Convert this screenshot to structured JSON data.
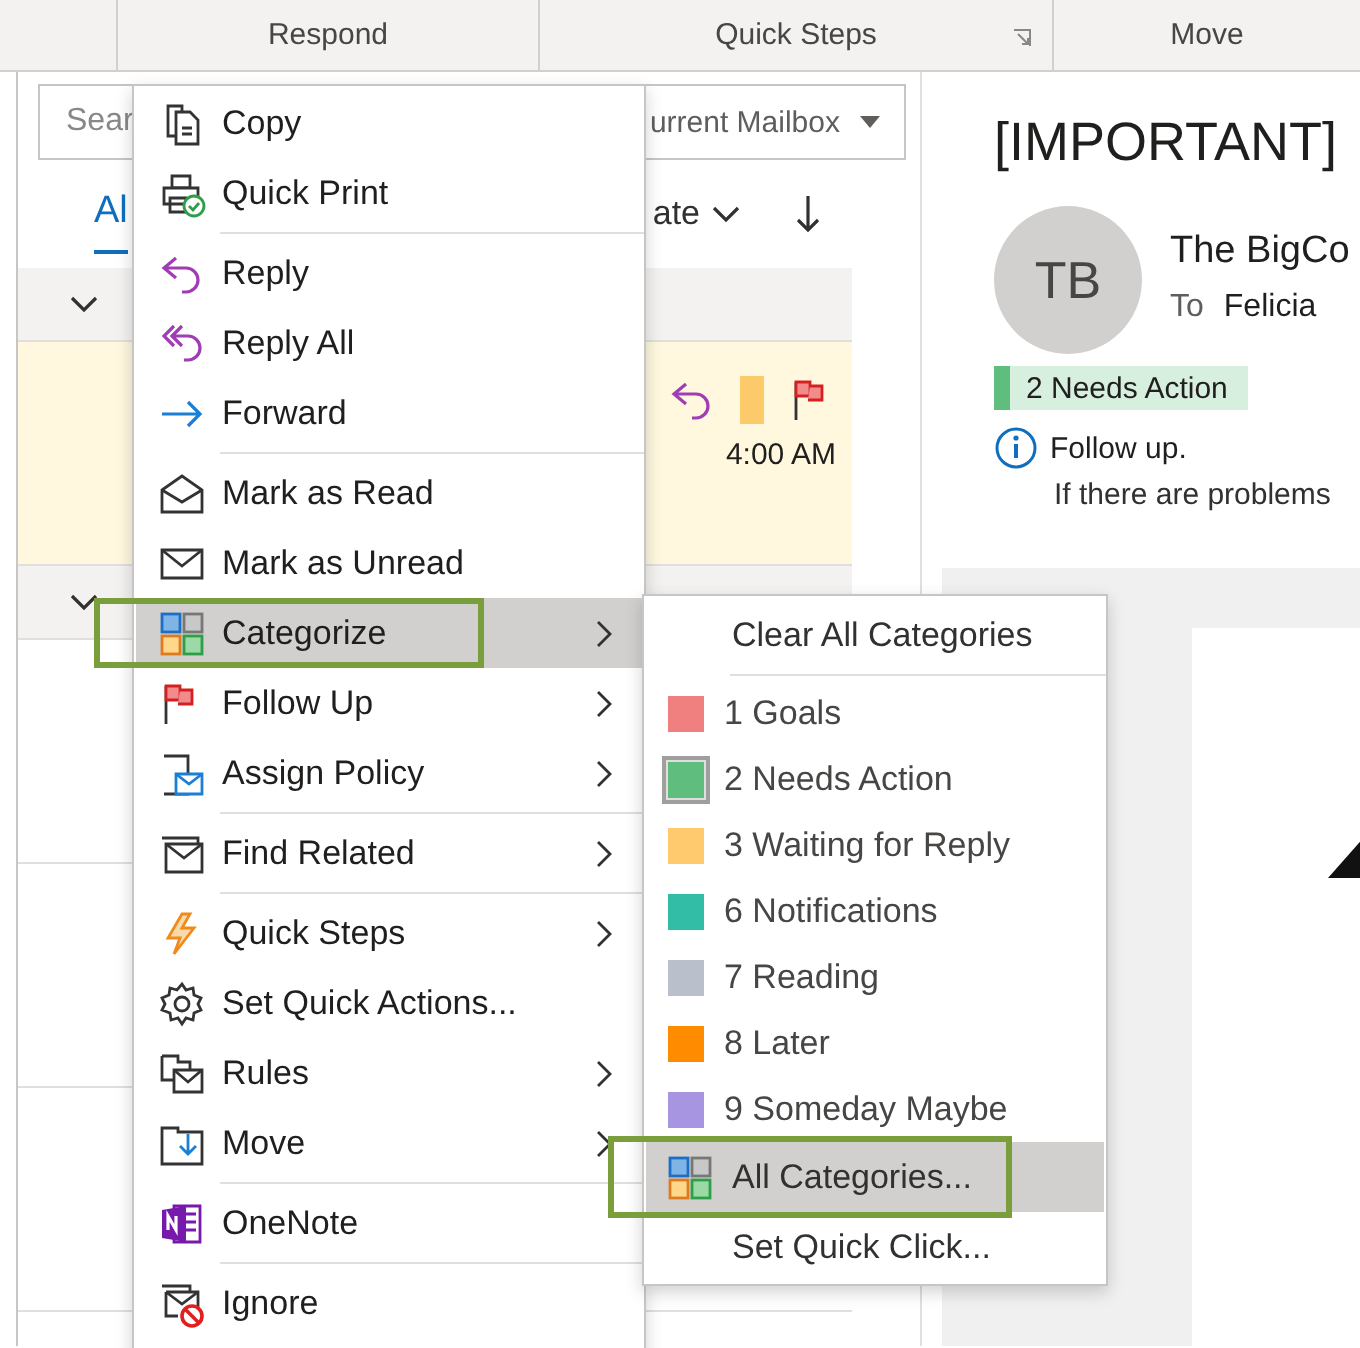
{
  "ribbon": {
    "groups": [
      {
        "label": "Respond",
        "launcher": false
      },
      {
        "label": "Quick Steps",
        "launcher": true
      },
      {
        "label": "Move",
        "launcher": false
      }
    ]
  },
  "mail_list": {
    "search": {
      "placeholder": "Sear",
      "scope": "urrent Mailbox"
    },
    "tabs": [
      {
        "label": "Al",
        "selected": true
      }
    ],
    "sort": {
      "label": "ate"
    },
    "groups": [
      {
        "expanded": true,
        "rows": [
          {
            "highlighted": true,
            "replied": true,
            "flagged": true,
            "color": "#fcc96b",
            "time": "4:00 AM"
          }
        ]
      },
      {
        "expanded": true,
        "rows": [
          {
            "highlighted": false,
            "replied": false,
            "flagged": false
          },
          {
            "highlighted": false,
            "replied": false,
            "flagged": false
          },
          {
            "highlighted": false,
            "replied": false,
            "flagged": false
          }
        ]
      }
    ]
  },
  "context_menu": {
    "items": [
      {
        "kind": "item",
        "label": "Copy",
        "submenu": false,
        "selected": false,
        "annotated": false
      },
      {
        "kind": "item",
        "label": "Quick Print",
        "submenu": false,
        "selected": false,
        "annotated": false
      },
      {
        "kind": "separator"
      },
      {
        "kind": "item",
        "label": "Reply",
        "submenu": false,
        "selected": false,
        "annotated": false
      },
      {
        "kind": "item",
        "label": "Reply All",
        "submenu": false,
        "selected": false,
        "annotated": false
      },
      {
        "kind": "item",
        "label": "Forward",
        "submenu": false,
        "selected": false,
        "annotated": false
      },
      {
        "kind": "separator"
      },
      {
        "kind": "item",
        "label": "Mark as Read",
        "submenu": false,
        "selected": false,
        "annotated": false
      },
      {
        "kind": "item",
        "label": "Mark as Unread",
        "submenu": false,
        "selected": false,
        "annotated": false
      },
      {
        "kind": "item",
        "label": "Categorize",
        "submenu": true,
        "selected": true,
        "annotated": true
      },
      {
        "kind": "item",
        "label": "Follow Up",
        "submenu": true,
        "selected": false,
        "annotated": false
      },
      {
        "kind": "item",
        "label": "Assign Policy",
        "submenu": true,
        "selected": false,
        "annotated": false
      },
      {
        "kind": "separator"
      },
      {
        "kind": "item",
        "label": "Find Related",
        "submenu": true,
        "selected": false,
        "annotated": false
      },
      {
        "kind": "separator"
      },
      {
        "kind": "item",
        "label": "Quick Steps",
        "submenu": true,
        "selected": false,
        "annotated": false
      },
      {
        "kind": "item",
        "label": "Set Quick Actions...",
        "submenu": false,
        "selected": false,
        "annotated": false
      },
      {
        "kind": "item",
        "label": "Rules",
        "submenu": true,
        "selected": false,
        "annotated": false
      },
      {
        "kind": "item",
        "label": "Move",
        "submenu": true,
        "selected": false,
        "annotated": false
      },
      {
        "kind": "separator"
      },
      {
        "kind": "item",
        "label": "OneNote",
        "submenu": false,
        "selected": false,
        "annotated": false
      },
      {
        "kind": "separator"
      },
      {
        "kind": "item",
        "label": "Ignore",
        "submenu": false,
        "selected": false,
        "annotated": false
      }
    ]
  },
  "categorize_submenu": {
    "items": [
      {
        "kind": "command",
        "label": "Clear All Categories",
        "selected": false,
        "annotated": false
      },
      {
        "kind": "separator"
      },
      {
        "kind": "category",
        "label": "1 Goals",
        "color": "#f08080",
        "checked": false
      },
      {
        "kind": "category",
        "label": "2 Needs Action",
        "color": "#5fbe7d",
        "checked": true
      },
      {
        "kind": "category",
        "label": "3 Waiting for Reply",
        "color": "#ffca6e",
        "checked": false
      },
      {
        "kind": "category",
        "label": "6 Notifications",
        "color": "#32bea6",
        "checked": false
      },
      {
        "kind": "category",
        "label": "7 Reading",
        "color": "#b9c0cb",
        "checked": false
      },
      {
        "kind": "category",
        "label": "8 Later",
        "color": "#ff8c00",
        "checked": false
      },
      {
        "kind": "category",
        "label": "9 Someday Maybe",
        "color": "#a895e2",
        "checked": false
      },
      {
        "kind": "command",
        "label": "All Categories...",
        "selected": true,
        "annotated": true
      },
      {
        "kind": "command",
        "label": "Set Quick Click...",
        "selected": false,
        "annotated": false
      }
    ]
  },
  "reading_pane": {
    "subject": "[IMPORTANT]",
    "avatar": "TB",
    "sender": "The BigCo",
    "to_label": "To",
    "to": "Felicia",
    "category": {
      "label": "2 Needs Action",
      "color": "#5fbe7d"
    },
    "info": {
      "title": "Follow up.",
      "text": "If there are problems"
    }
  }
}
